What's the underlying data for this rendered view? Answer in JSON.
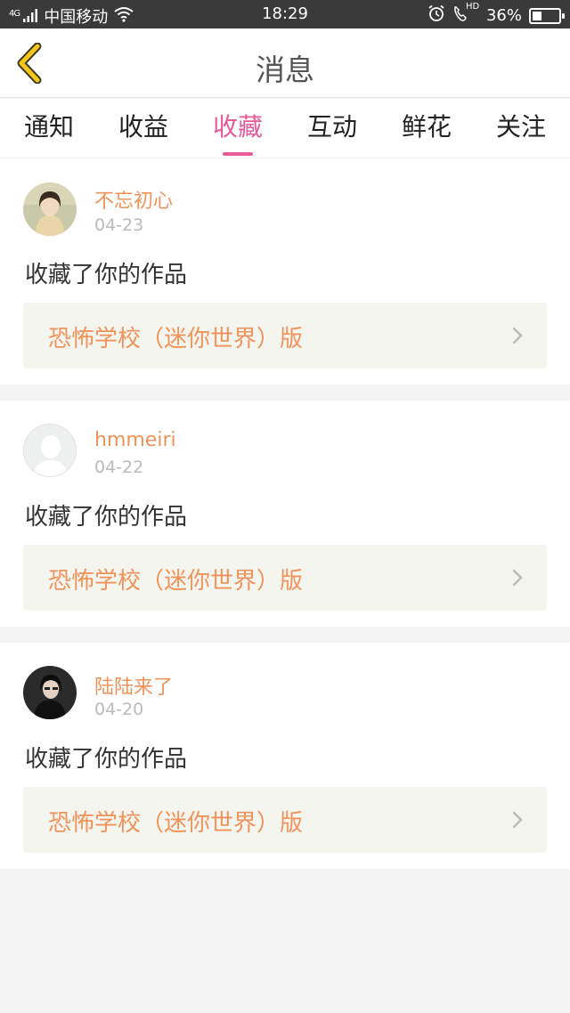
{
  "status_bar": {
    "carrier": "中国移动",
    "network": "4G",
    "time": "18:29",
    "hd": "HD",
    "battery": "36%",
    "battery_level": 0.36
  },
  "header": {
    "title": "消息"
  },
  "tabs": [
    {
      "label": "通知",
      "active": false
    },
    {
      "label": "收益",
      "active": false
    },
    {
      "label": "收藏",
      "active": true
    },
    {
      "label": "互动",
      "active": false
    },
    {
      "label": "鲜花",
      "active": false
    },
    {
      "label": "关注",
      "active": false
    }
  ],
  "messages": [
    {
      "username": "不忘初心",
      "date": "04-23",
      "action": "收藏了你的作品",
      "work_title": "恐怖学校（迷你世界）版"
    },
    {
      "username": "hmmeiri",
      "date": "04-22",
      "action": "收藏了你的作品",
      "work_title": "恐怖学校（迷你世界）版"
    },
    {
      "username": "陆陆来了",
      "date": "04-20",
      "action": "收藏了你的作品",
      "work_title": "恐怖学校（迷你世界）版"
    }
  ],
  "colors": {
    "accent_pink": "#e85a9a",
    "name_orange": "#f0935a",
    "back_yellow": "#f5c518",
    "status_bar": "#3a3a3a"
  }
}
